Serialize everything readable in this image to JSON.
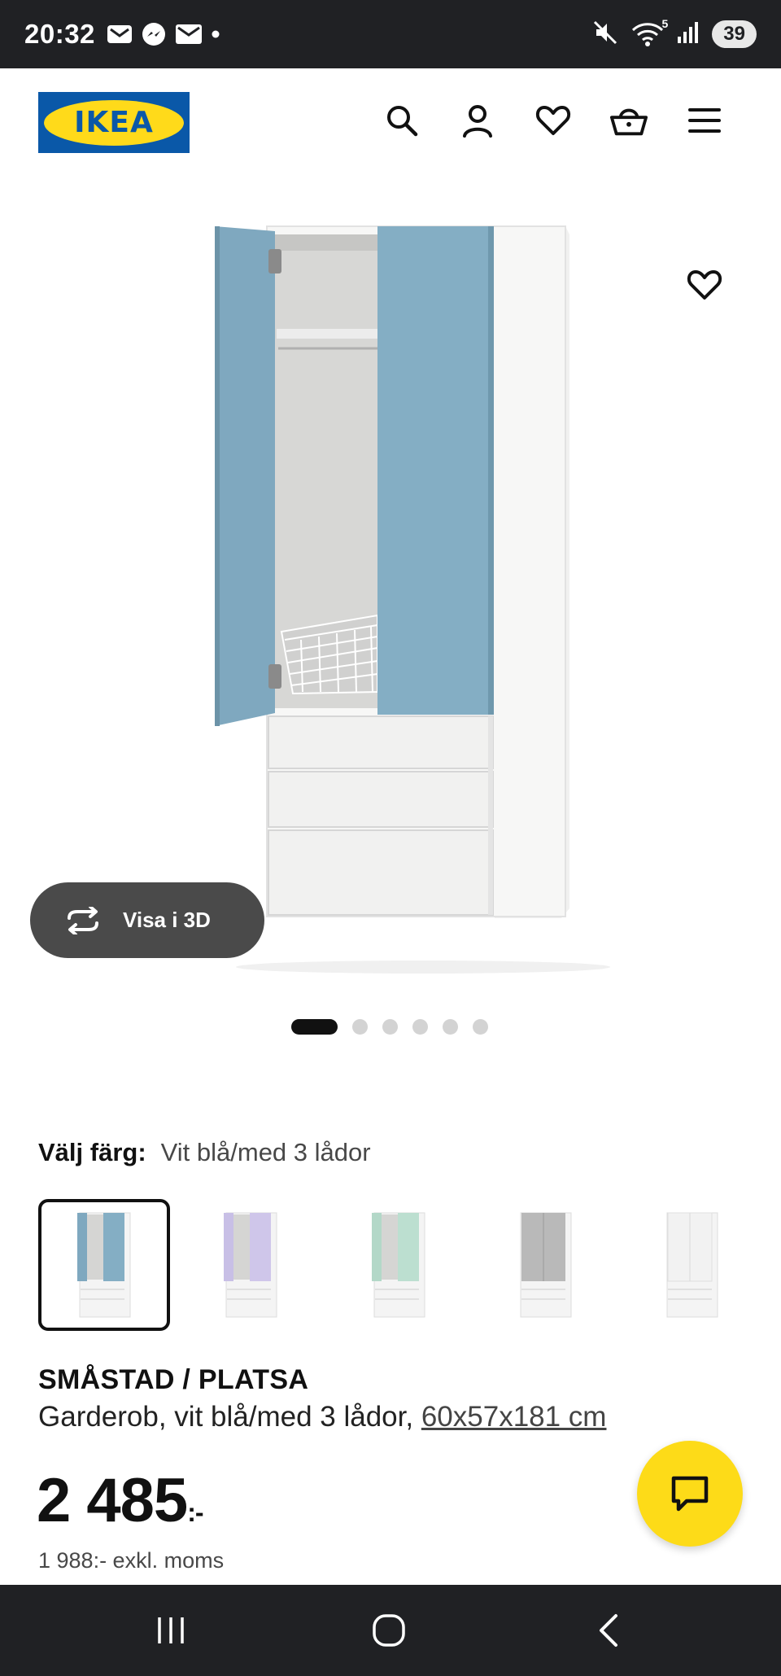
{
  "status_bar": {
    "time": "20:32",
    "battery": "39",
    "wifi_label": "5"
  },
  "brand": {
    "logo_text": "IKEA",
    "blue": "#0a58a8",
    "yellow": "#ffda1a"
  },
  "header_icons": [
    "search-icon",
    "account-icon",
    "favourites-icon",
    "basket-icon",
    "menu-icon"
  ],
  "gallery": {
    "view_3d_label": "Visa i 3D",
    "image_count": 6,
    "active_index": 0
  },
  "color_picker": {
    "label": "Välj färg:",
    "selected_value": "Vit blå/med 3 lådor",
    "options": [
      {
        "door_color": "#7fa8bf",
        "selected": true
      },
      {
        "door_color": "#c8bfe6"
      },
      {
        "door_color": "#b3d8c8"
      },
      {
        "door_color": "#b9b9b9"
      },
      {
        "door_color": "#f2f2f2"
      }
    ]
  },
  "product": {
    "name": "SMÅSTAD / PLATSA",
    "description": "Garderob, vit blå/med 3 lådor,",
    "dimensions": "60x57x181 cm",
    "price": "2 485",
    "price_suffix": ":-",
    "price_excl_vat": "1 988:- exkl. moms"
  }
}
